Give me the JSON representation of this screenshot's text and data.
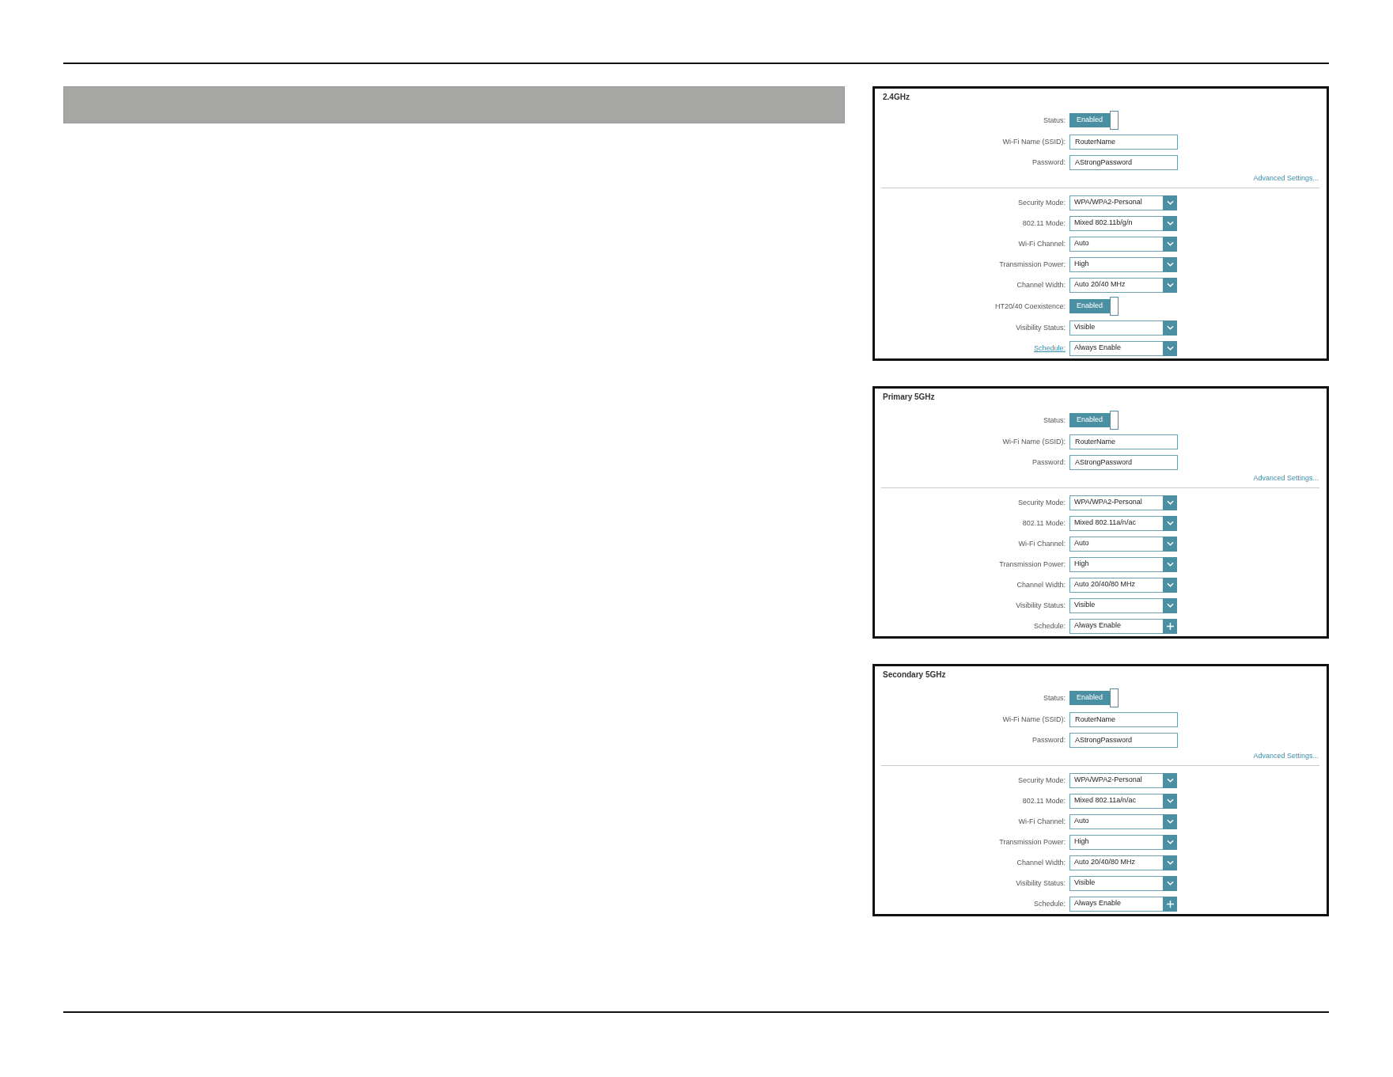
{
  "panels": [
    {
      "title": "2.4GHz",
      "basic": [
        {
          "kind": "toggle",
          "label": "Status:",
          "value": "Enabled",
          "on": true
        },
        {
          "kind": "input",
          "label": "Wi-Fi Name (SSID):",
          "value": "RouterName"
        },
        {
          "kind": "input",
          "label": "Password:",
          "value": "AStrongPassword"
        }
      ],
      "advanced_link": "Advanced Settings...",
      "advanced": [
        {
          "kind": "dropdown",
          "label": "Security Mode:",
          "value": "WPA/WPA2-Personal"
        },
        {
          "kind": "dropdown",
          "label": "802.11 Mode:",
          "value": "Mixed 802.11b/g/n"
        },
        {
          "kind": "dropdown",
          "label": "Wi-Fi Channel:",
          "value": "Auto"
        },
        {
          "kind": "dropdown",
          "label": "Transmission Power:",
          "value": "High"
        },
        {
          "kind": "dropdown",
          "label": "Channel Width:",
          "value": "Auto 20/40 MHz"
        },
        {
          "kind": "toggle",
          "label": "HT20/40 Coexistence:",
          "value": "Enabled",
          "on": true
        },
        {
          "kind": "dropdown",
          "label": "Visibility Status:",
          "value": "Visible"
        },
        {
          "kind": "dropdown",
          "label": "Schedule:",
          "value": "Always Enable",
          "link": true
        }
      ]
    },
    {
      "title": "Primary 5GHz",
      "basic": [
        {
          "kind": "toggle",
          "label": "Status:",
          "value": "Enabled",
          "on": true
        },
        {
          "kind": "input",
          "label": "Wi-Fi Name (SSID):",
          "value": "RouterName"
        },
        {
          "kind": "input",
          "label": "Password:",
          "value": "AStrongPassword"
        }
      ],
      "advanced_link": "Advanced Settings...",
      "advanced": [
        {
          "kind": "dropdown",
          "label": "Security Mode:",
          "value": "WPA/WPA2-Personal"
        },
        {
          "kind": "dropdown",
          "label": "802.11 Mode:",
          "value": "Mixed 802.11a/n/ac"
        },
        {
          "kind": "dropdown",
          "label": "Wi-Fi Channel:",
          "value": "Auto"
        },
        {
          "kind": "dropdown",
          "label": "Transmission Power:",
          "value": "High"
        },
        {
          "kind": "dropdown",
          "label": "Channel Width:",
          "value": "Auto 20/40/80 MHz"
        },
        {
          "kind": "dropdown",
          "label": "Visibility Status:",
          "value": "Visible"
        },
        {
          "kind": "adder",
          "label": "Schedule:",
          "value": "Always Enable",
          "link": false
        }
      ]
    },
    {
      "title": "Secondary 5GHz",
      "basic": [
        {
          "kind": "toggle",
          "label": "Status:",
          "value": "Enabled",
          "on": true
        },
        {
          "kind": "input",
          "label": "Wi-Fi Name (SSID):",
          "value": "RouterName"
        },
        {
          "kind": "input",
          "label": "Password:",
          "value": "AStrongPassword"
        }
      ],
      "advanced_link": "Advanced Settings...",
      "advanced": [
        {
          "kind": "dropdown",
          "label": "Security Mode:",
          "value": "WPA/WPA2-Personal"
        },
        {
          "kind": "dropdown",
          "label": "802.11 Mode:",
          "value": "Mixed 802.11a/n/ac"
        },
        {
          "kind": "dropdown",
          "label": "Wi-Fi Channel:",
          "value": "Auto"
        },
        {
          "kind": "dropdown",
          "label": "Transmission Power:",
          "value": "High"
        },
        {
          "kind": "dropdown",
          "label": "Channel Width:",
          "value": "Auto 20/40/80 MHz"
        },
        {
          "kind": "dropdown",
          "label": "Visibility Status:",
          "value": "Visible"
        },
        {
          "kind": "adder",
          "label": "Schedule:",
          "value": "Always Enable",
          "link": false
        }
      ]
    }
  ]
}
